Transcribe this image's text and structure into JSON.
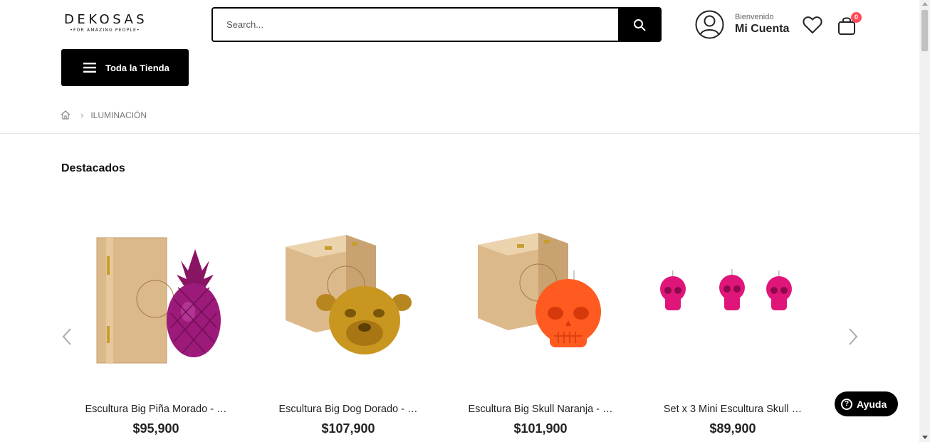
{
  "header": {
    "logo_brand": "DEKOSAS",
    "logo_tagline": "•FOR AMAZING PEOPLE•",
    "search_placeholder": "Search...",
    "welcome_text": "Bienvenido",
    "account_label": "Mi Cuenta",
    "cart_count": "0",
    "icons": {
      "search": "search-icon",
      "account": "user-icon",
      "wishlist": "heart-icon",
      "cart": "shopping-bag-icon",
      "menu": "hamburger-icon"
    }
  },
  "nav": {
    "store_button_label": "Toda la Tienda"
  },
  "breadcrumb": {
    "home_icon": "home-icon",
    "current": "ILUMINACIÓN"
  },
  "section": {
    "title": "Destacados"
  },
  "products": [
    {
      "name": "Escultura Big Piña Morado - …",
      "price": "$95,900",
      "color": "#9b1a7a"
    },
    {
      "name": "Escultura Big Dog Dorado - …",
      "price": "$107,900",
      "color": "#c9961f"
    },
    {
      "name": "Escultura Big Skull Naranja - …",
      "price": "$101,900",
      "color": "#ff5a1f"
    },
    {
      "name": "Set x 3 Mini Escultura Skull …",
      "price": "$89,900",
      "color": "#e0157a"
    }
  ],
  "help": {
    "label": "Ayuda"
  },
  "colors": {
    "accent": "#000000",
    "badge": "#ff4a5a"
  }
}
